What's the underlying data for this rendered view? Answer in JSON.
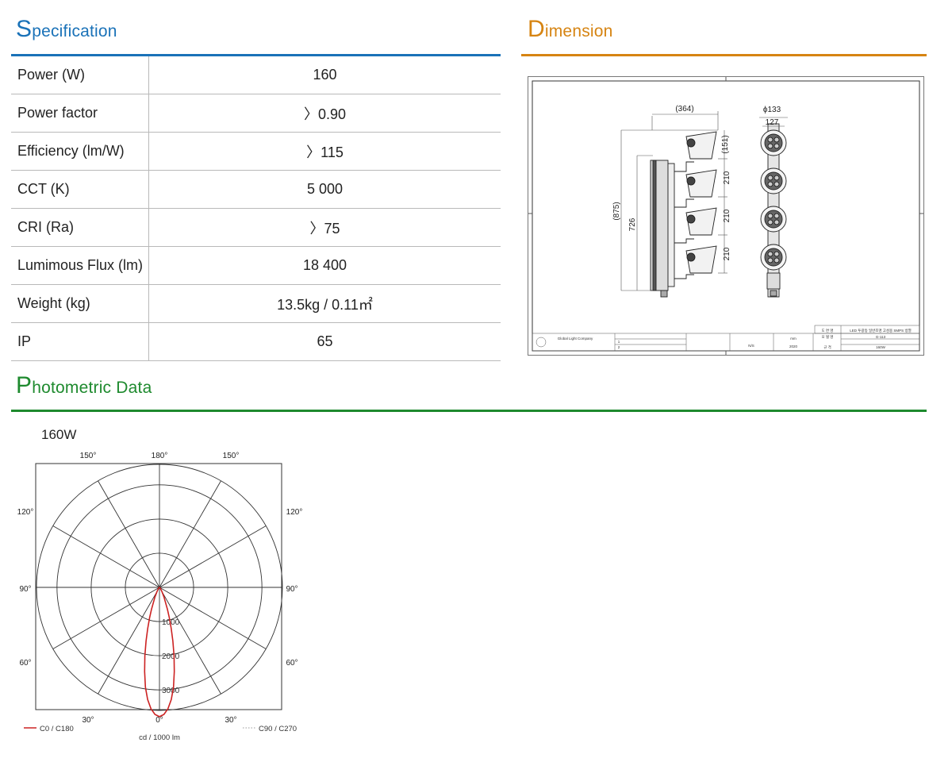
{
  "specification": {
    "title_cap": "S",
    "title_rest": "pecification",
    "rows": [
      {
        "label": "Power (W)",
        "value": "160"
      },
      {
        "label": "Power factor",
        "value": "〉0.90"
      },
      {
        "label": "Efficiency (lm/W)",
        "value": "〉115"
      },
      {
        "label": "CCT (K)",
        "value": "5 000"
      },
      {
        "label": "CRI (Ra)",
        "value": "〉75"
      },
      {
        "label": "Lumimous Flux (lm)",
        "value": "18 400"
      },
      {
        "label": "Weight (kg)",
        "value": "13.5kg / 0.11㎡"
      },
      {
        "label": "IP",
        "value": "65"
      }
    ]
  },
  "dimension": {
    "title_cap": "D",
    "title_rest": "imension",
    "drawing": {
      "width_label": "(364)",
      "head_label": "(151)",
      "total_height_label": "(875)",
      "body_height_label": "726",
      "spacing_labels": [
        "210",
        "210",
        "210"
      ],
      "diameter_label": "ϕ133",
      "inner_label": "127",
      "title_block": {
        "company": "Global Light Company",
        "drawing_title": "LED 투광등 일반조명 고성용 SMPS 방열",
        "model_no": "G-113",
        "spec": "160W",
        "scale": "N/S",
        "unit": "mm",
        "year": "2020",
        "rev": [
          "1",
          "2"
        ],
        "field_labels": [
          "도 면 명",
          "모 델 명",
          "규 격"
        ]
      }
    }
  },
  "photometric": {
    "title_cap": "P",
    "title_rest": "hotometric Data",
    "wattage": "160W",
    "chart_data": {
      "type": "polar",
      "title": "160W",
      "angle_labels_top": [
        "150°",
        "180°",
        "150°"
      ],
      "angle_labels_mid_upper": [
        "120°",
        "120°"
      ],
      "angle_labels_mid": [
        "90°",
        "90°"
      ],
      "angle_labels_mid_lower": [
        "60°",
        "60°"
      ],
      "angle_labels_bottom": [
        "30°",
        "0°",
        "30°"
      ],
      "radial_ticks": [
        1000,
        2000,
        3000
      ],
      "radial_max": 3600,
      "unit_label": "cd / 1000 lm",
      "series": [
        {
          "name": "C0 / C180",
          "color": "#cc2222",
          "style": "solid",
          "angles_deg": [
            0,
            2,
            4,
            6,
            8,
            10,
            12,
            14,
            16,
            18,
            20,
            25,
            30,
            40,
            60,
            90
          ],
          "values": [
            3780,
            3720,
            3560,
            3300,
            2950,
            2500,
            2050,
            1620,
            1250,
            930,
            680,
            320,
            150,
            50,
            10,
            0
          ]
        },
        {
          "name": "C90 / C270",
          "color": "#999999",
          "style": "dotted",
          "angles_deg": [],
          "values": []
        }
      ]
    }
  }
}
